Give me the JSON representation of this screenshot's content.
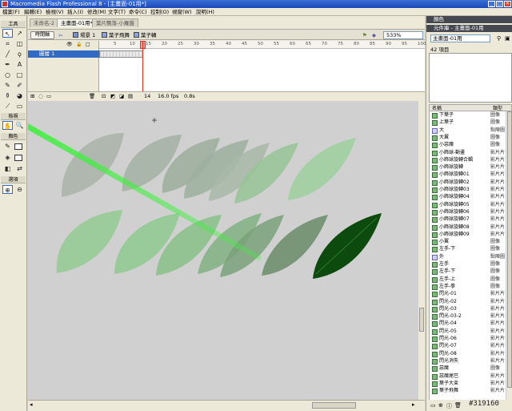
{
  "window": {
    "title": "Macromedia Flash Professional 8 - [主畫面-01用*]"
  },
  "menu": [
    "檔案(F)",
    "編輯(E)",
    "檢視(V)",
    "插入(I)",
    "修改(M)",
    "文字(T)",
    "命令(C)",
    "控制(O)",
    "視窗(W)",
    "說明(H)"
  ],
  "toolbox": {
    "title": "工具",
    "view_label": "檢視",
    "colors_label": "顏色",
    "options_label": "選項"
  },
  "document_tabs": [
    {
      "label": "未命名-2"
    },
    {
      "label": "主畫面-01用*"
    },
    {
      "label": "葉片飄落-小羅盤"
    }
  ],
  "timeline": {
    "toggle_label": "時間軸",
    "scene_label": "場景 1",
    "breadcrumbs": [
      "葉子飛舞",
      "葉子轉"
    ],
    "zoom": "533%",
    "layer_name": "圖層 1",
    "ruler_ticks": [
      "5",
      "10",
      "15",
      "20",
      "25",
      "30",
      "35",
      "40",
      "45",
      "50",
      "55",
      "60",
      "65",
      "70",
      "75",
      "80",
      "85",
      "90",
      "95",
      "100",
      "105"
    ],
    "current_frame": "14",
    "fps": "16.0 fps",
    "elapsed": "0.8s"
  },
  "panels": {
    "color_title": "顏色",
    "library_title": "元件庫 - 主畫面-01用",
    "library_select": "主畫面-01用",
    "library_count": "42 項目",
    "col_name": "名稱",
    "col_type": "類型"
  },
  "library_items": [
    {
      "name": "下葉子",
      "type": "圖像",
      "kind": "sym"
    },
    {
      "name": "上葉子",
      "type": "圖像",
      "kind": "sym"
    },
    {
      "name": "大",
      "type": "點陣圖",
      "kind": "bmp"
    },
    {
      "name": "大翼",
      "type": "圖像",
      "kind": "sym"
    },
    {
      "name": "小惡魔",
      "type": "圖像",
      "kind": "sym"
    },
    {
      "name": "小飾球-動畫",
      "type": "影片片",
      "kind": "sym"
    },
    {
      "name": "小飾球旋轉合輯",
      "type": "影片片",
      "kind": "sym"
    },
    {
      "name": "小飾球旋轉",
      "type": "影片片",
      "kind": "sym"
    },
    {
      "name": "小飾球旋轉01",
      "type": "影片片",
      "kind": "sym"
    },
    {
      "name": "小飾球旋轉02",
      "type": "影片片",
      "kind": "sym"
    },
    {
      "name": "小飾球旋轉03",
      "type": "影片片",
      "kind": "sym"
    },
    {
      "name": "小飾球旋轉04",
      "type": "影片片",
      "kind": "sym"
    },
    {
      "name": "小飾球旋轉05",
      "type": "影片片",
      "kind": "sym"
    },
    {
      "name": "小飾球旋轉06",
      "type": "影片片",
      "kind": "sym"
    },
    {
      "name": "小飾球旋轉07",
      "type": "影片片",
      "kind": "sym"
    },
    {
      "name": "小飾球旋轉08",
      "type": "影片片",
      "kind": "sym"
    },
    {
      "name": "小飾球旋轉09",
      "type": "影片片",
      "kind": "sym"
    },
    {
      "name": "小翼",
      "type": "圖像",
      "kind": "sym"
    },
    {
      "name": "左手-下",
      "type": "圖像",
      "kind": "sym"
    },
    {
      "name": "外",
      "type": "點陣圖",
      "kind": "bmp"
    },
    {
      "name": "左手",
      "type": "圖像",
      "kind": "sym"
    },
    {
      "name": "左手-下",
      "type": "圖像",
      "kind": "sym"
    },
    {
      "name": "左手-上",
      "type": "圖像",
      "kind": "sym"
    },
    {
      "name": "左手-拳",
      "type": "圖像",
      "kind": "sym"
    },
    {
      "name": "閃光-01",
      "type": "影片片",
      "kind": "sym"
    },
    {
      "name": "閃光-02",
      "type": "影片片",
      "kind": "sym"
    },
    {
      "name": "閃光-03",
      "type": "影片片",
      "kind": "sym"
    },
    {
      "name": "閃光-03-2",
      "type": "影片片",
      "kind": "sym"
    },
    {
      "name": "閃光-04",
      "type": "影片片",
      "kind": "sym"
    },
    {
      "name": "閃光-05",
      "type": "影片片",
      "kind": "sym"
    },
    {
      "name": "閃光-06",
      "type": "影片片",
      "kind": "sym"
    },
    {
      "name": "閃光-07",
      "type": "影片片",
      "kind": "sym"
    },
    {
      "name": "閃光-08",
      "type": "影片片",
      "kind": "sym"
    },
    {
      "name": "閃光消失",
      "type": "影片片",
      "kind": "sym"
    },
    {
      "name": "惡魔",
      "type": "圖像",
      "kind": "sym"
    },
    {
      "name": "惡魔尾巴",
      "type": "影片片",
      "kind": "sym"
    },
    {
      "name": "葉子大束",
      "type": "影片片",
      "kind": "sym"
    },
    {
      "name": "葉子飛舞",
      "type": "影片片",
      "kind": "sym"
    }
  ],
  "colors": {
    "leaf_dark": "#0d4a0d",
    "leaf_light": "#8fc98f",
    "light_beam": "#3ef03e",
    "playhead": "#dd3322",
    "selection": "#316ac5"
  },
  "watermark": "#319160"
}
